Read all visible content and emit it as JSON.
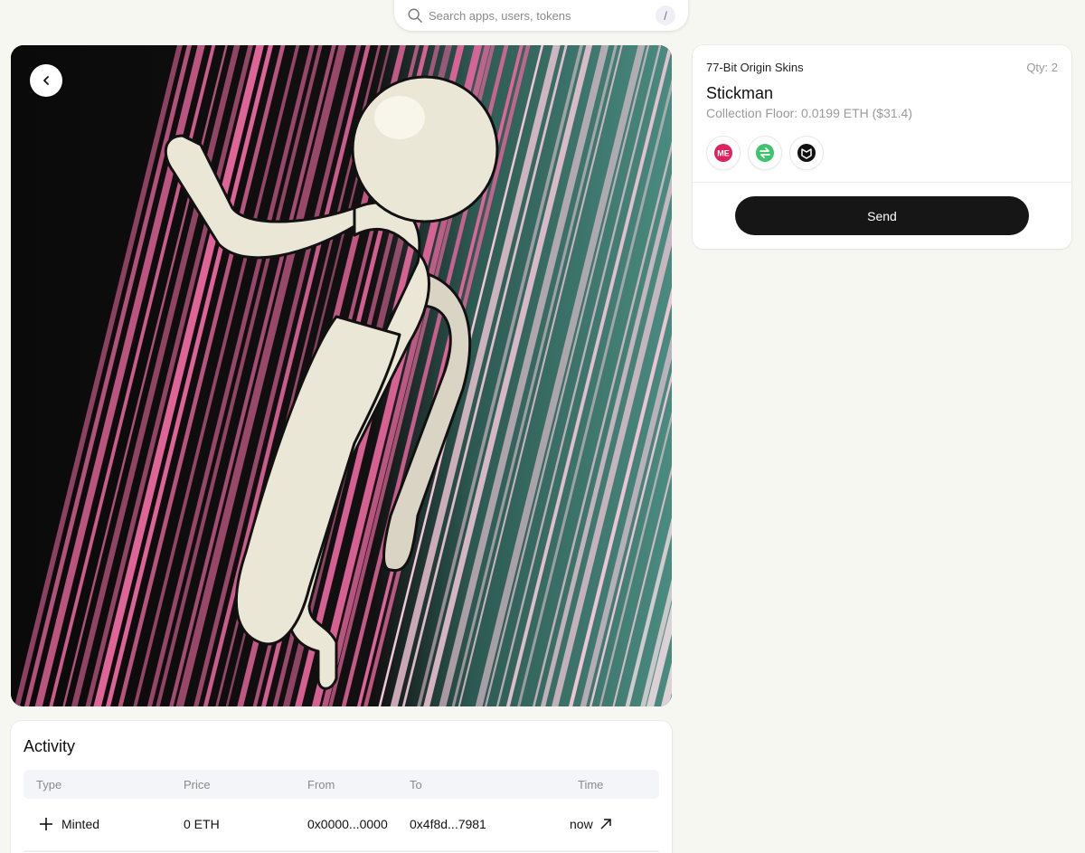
{
  "search": {
    "placeholder": "Search apps, users, tokens",
    "shortcut": "/"
  },
  "nft": {
    "collection": "77-Bit Origin Skins",
    "quantity": "Qty: 2",
    "name": "Stickman",
    "floor": "Collection Floor: 0.0199 ETH ($31.4)",
    "markets": [
      {
        "icon": "magic-eden-icon",
        "color": "#e0215f"
      },
      {
        "icon": "swap-icon",
        "color": "#3fc36c"
      },
      {
        "icon": "marketplace-icon",
        "color": "#111111"
      }
    ],
    "send_label": "Send"
  },
  "activity": {
    "title": "Activity",
    "columns": [
      "Type",
      "Price",
      "From",
      "To",
      "Time"
    ],
    "rows": [
      {
        "type": "Minted",
        "price": "0 ETH",
        "from": "0x0000...0000",
        "to": "0x4f8d...7981",
        "time": "now"
      }
    ]
  },
  "colors": {
    "accent": "#161616",
    "background": "#f7f7f2",
    "stripe_pink": "#e2659a",
    "stripe_teal": "#3f8579"
  }
}
